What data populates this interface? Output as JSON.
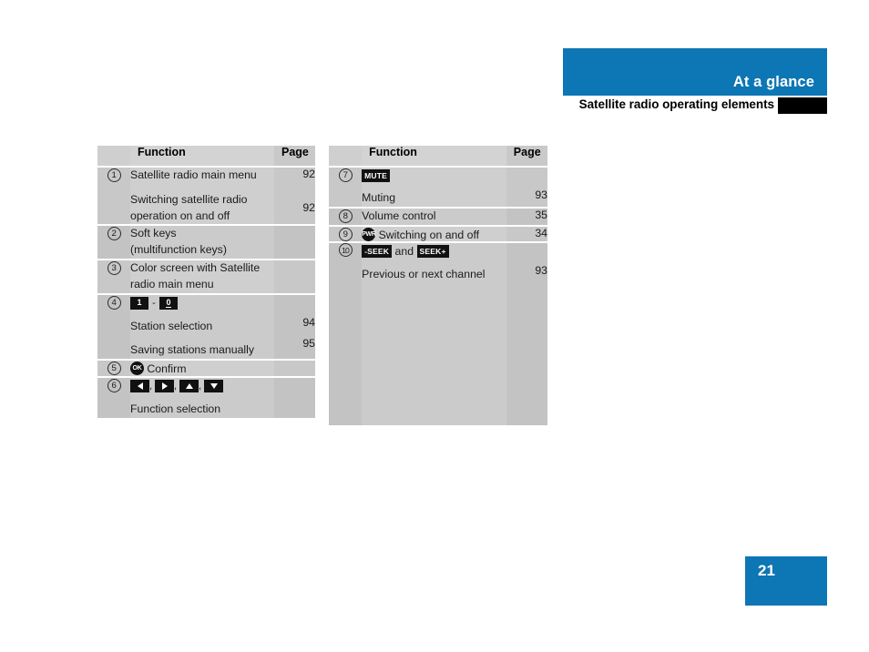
{
  "header": {
    "band_title": "At a glance",
    "subtitle": "Satellite radio operating elements",
    "band_color": "#0d76b4",
    "bar_color": "#000000"
  },
  "page_number": "21",
  "tables": {
    "left": {
      "columns": {
        "number": "",
        "function": "Function",
        "page": "Page"
      },
      "rows": [
        {
          "number": "1",
          "lines": [
            "Satellite radio main menu",
            "",
            "Switching satellite radio",
            "operation on and off"
          ],
          "line1": "Satellite radio main menu",
          "line2": "Switching satellite radio",
          "line3": "operation on and off",
          "page1": "92",
          "page2": "92"
        },
        {
          "number": "2",
          "line1": "Soft keys",
          "line2": "(multifunction keys)",
          "page1": ""
        },
        {
          "number": "3",
          "line1": "Color screen with Satellite",
          "line2": "radio main menu",
          "page1": ""
        },
        {
          "number": "4",
          "keys": {
            "from": "1",
            "dash": "-",
            "to": "0"
          },
          "line1": "Station selection",
          "line2": "Saving stations manually",
          "page1": "94",
          "page2": "95"
        },
        {
          "number": "5",
          "key_circle": "OK",
          "line1": "Confirm",
          "page1": ""
        },
        {
          "number": "6",
          "arrows": [
            "left",
            "right",
            "up",
            "down"
          ],
          "separator": ",",
          "line1": "Function selection",
          "page1": ""
        }
      ]
    },
    "right": {
      "columns": {
        "number": "",
        "function": "Function",
        "page": "Page"
      },
      "rows": [
        {
          "number": "7",
          "key_word": "MUTE",
          "line1": "Muting",
          "page1": "93"
        },
        {
          "number": "8",
          "line1": "Volume control",
          "page1": "35"
        },
        {
          "number": "9",
          "key_circle": "PWR",
          "line1": "Switching on and off",
          "page1": "34"
        },
        {
          "number": "10",
          "key_word_a": "-SEEK",
          "conjunction": "and",
          "key_word_b": "SEEK+",
          "line1": "Previous or next channel",
          "page1": "93"
        }
      ]
    }
  }
}
